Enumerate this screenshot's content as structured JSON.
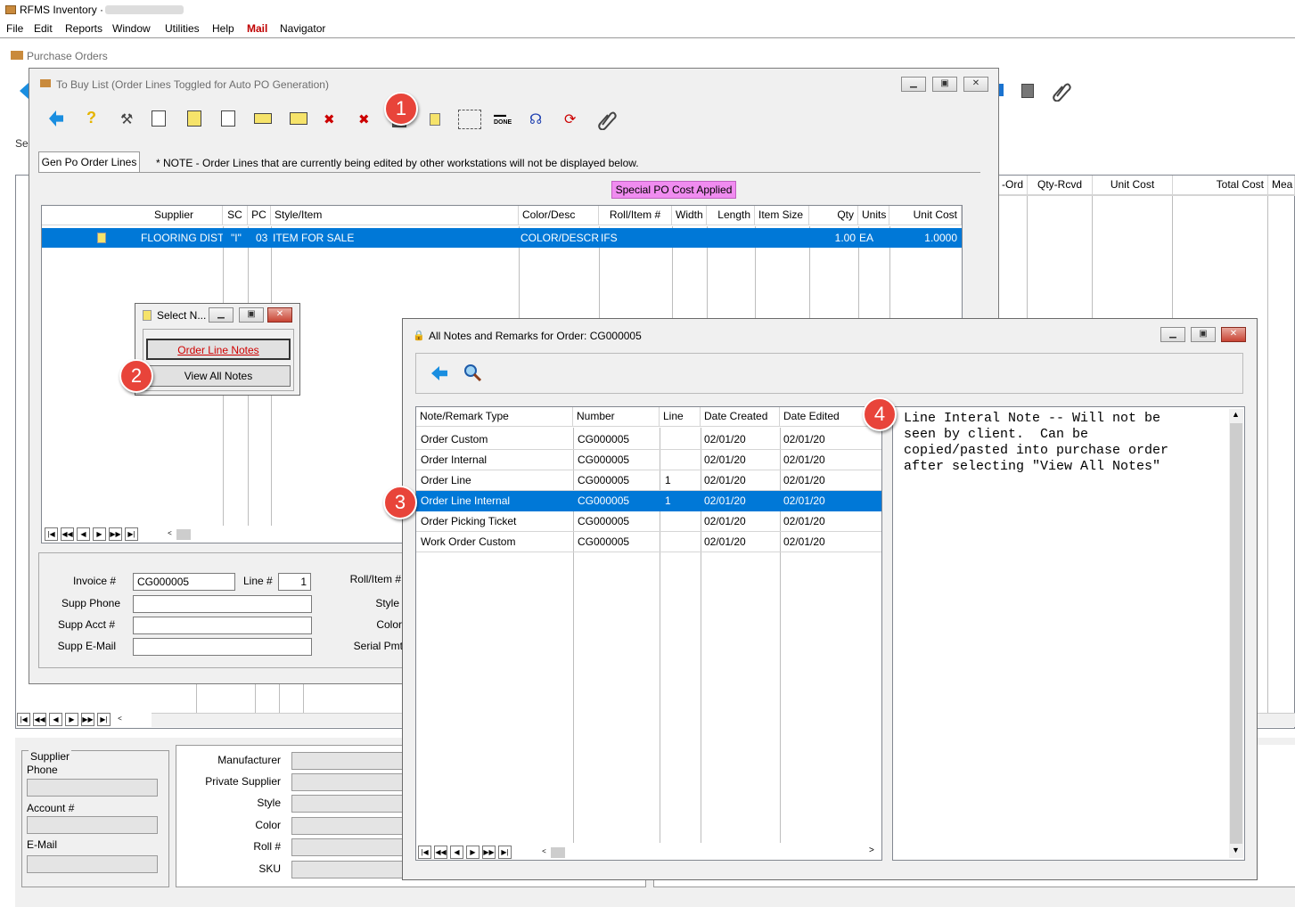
{
  "app": {
    "title": "RFMS Inventory ·"
  },
  "menu": [
    "File",
    "Edit",
    "Reports",
    "Window",
    "Utilities",
    "Help",
    "Mail",
    "Navigator"
  ],
  "purchase_orders": {
    "title": "Purchase Orders",
    "search_label": "Sea",
    "right_headers": [
      "-Ord",
      "Qty-Rcvd",
      "Unit Cost",
      "Total Cost",
      "Mea"
    ],
    "supplier_box": {
      "title": "Supplier",
      "phone": "Phone",
      "account": "Account #",
      "email": "E-Mail"
    },
    "product_labels": [
      "Manufacturer",
      "Private Supplier",
      "Style",
      "Color",
      "Roll #",
      "SKU"
    ]
  },
  "to_buy": {
    "title": "To Buy List  (Order Lines Toggled for Auto PO Generation)",
    "tab": "Gen Po Order Lines",
    "note": "* NOTE - Order Lines that are currently being edited by other workstations will not be displayed below.",
    "special_badge": "Special PO Cost Applied",
    "headers": [
      "Supplier",
      "SC",
      "PC",
      "Style/Item",
      "Color/Desc",
      "Roll/Item #",
      "Width",
      "Length",
      "Item Size",
      "Qty",
      "Units",
      "Unit Cost"
    ],
    "row": {
      "supplier": "FLOORING DISTRI",
      "sc": "\"I\"",
      "pc": "03",
      "style": "ITEM FOR SALE",
      "color": "COLOR/DESCRIP",
      "roll": "IFS",
      "width": "",
      "length": "",
      "size": "",
      "qty": "1.00",
      "units": "EA",
      "unit_cost": "1.0000"
    },
    "form": {
      "invoice_label": "Invoice #",
      "invoice": "CG000005",
      "line_label": "Line #",
      "line": "1",
      "phone_label": "Supp Phone",
      "acct_label": "Supp Acct #",
      "email_label": "Supp E-Mail",
      "roll_label": "Roll/Item #",
      "style_label": "Style",
      "color_label": "Color",
      "serial_label": "Serial Pmt"
    }
  },
  "select_notes": {
    "title": "Select N...",
    "btn1": "Order Line Notes",
    "btn2": "View All Notes"
  },
  "all_notes": {
    "title": "All Notes and Remarks for Order:  CG000005",
    "headers": [
      "Note/Remark Type",
      "Number",
      "Line",
      "Date Created",
      "Date Edited"
    ],
    "rows": [
      {
        "type": "Order Custom",
        "number": "CG000005",
        "line": "",
        "created": "02/01/20",
        "edited": "02/01/20"
      },
      {
        "type": "Order Internal",
        "number": "CG000005",
        "line": "",
        "created": "02/01/20",
        "edited": "02/01/20"
      },
      {
        "type": "Order Line",
        "number": "CG000005",
        "line": "1",
        "created": "02/01/20",
        "edited": "02/01/20"
      },
      {
        "type": "Order Line Internal",
        "number": "CG000005",
        "line": "1",
        "created": "02/01/20",
        "edited": "02/01/20"
      },
      {
        "type": "Order Picking Ticket",
        "number": "CG000005",
        "line": "",
        "created": "02/01/20",
        "edited": "02/01/20"
      },
      {
        "type": "Work Order Custom",
        "number": "CG000005",
        "line": "",
        "created": "02/01/20",
        "edited": "02/01/20"
      }
    ],
    "note_text": "Line Interal Note -- Will not be\nseen by client.  Can be\ncopied/pasted into purchase order\nafter selecting \"View All Notes\""
  },
  "badges": [
    "1",
    "2",
    "3",
    "4"
  ],
  "colors": {
    "selection": "#0078d7",
    "badge": "#e8443a",
    "special": "#f08cf0",
    "mail": "#c00000"
  }
}
